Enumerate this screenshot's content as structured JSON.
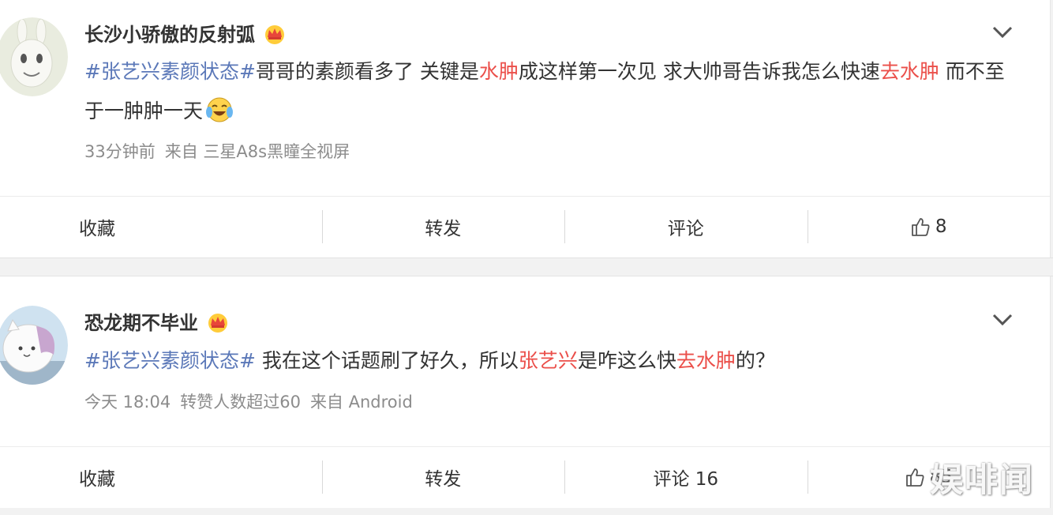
{
  "posts": [
    {
      "username": "长沙小骄傲的反射弧",
      "content": [
        {
          "text": "#张艺兴素颜状态#",
          "style": "tag"
        },
        {
          "text": "哥哥的素颜看多了 关键是",
          "style": "plain"
        },
        {
          "text": "水肿",
          "style": "hl"
        },
        {
          "text": "成这样第一次见 求大帅哥告诉我怎么快速",
          "style": "plain"
        },
        {
          "text": "去水肿",
          "style": "hl"
        },
        {
          "text": " 而不至于一肿肿一天",
          "style": "plain"
        }
      ],
      "meta": [
        "33分钟前",
        "来自 三星A8s黑瞳全视屏"
      ],
      "actions": {
        "favorite": "收藏",
        "repost": "转发",
        "comment": "评论",
        "like_count": "8"
      }
    },
    {
      "username": "恐龙期不毕业",
      "content": [
        {
          "text": "#张艺兴素颜状态#",
          "style": "tag"
        },
        {
          "text": " 我在这个话题刷了好久，所以",
          "style": "plain"
        },
        {
          "text": "张艺兴",
          "style": "hl"
        },
        {
          "text": "是咋这么快",
          "style": "plain"
        },
        {
          "text": "去水肿",
          "style": "hl"
        },
        {
          "text": "的？",
          "style": "plain"
        }
      ],
      "meta": [
        "今天 18:04",
        "转赞人数超过60",
        "来自 Android"
      ],
      "actions": {
        "favorite": "收藏",
        "repost": "转发",
        "comment": "评论 16",
        "like_count": "85"
      }
    }
  ],
  "watermark": "娱啡闻",
  "colors": {
    "highlight": "#eb4f4a",
    "topic": "#5b78b8",
    "meta": "#8c8c8c"
  },
  "icons": [
    "crown-icon",
    "chevron-down-icon",
    "thumbs-up-icon",
    "crying-laughing-emoji"
  ]
}
